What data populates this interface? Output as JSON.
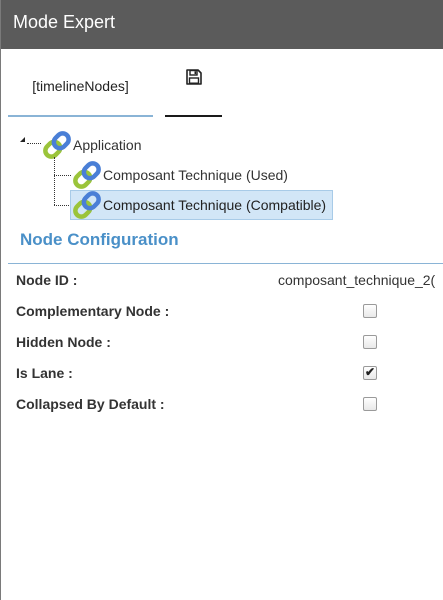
{
  "window": {
    "title": "Mode Expert"
  },
  "tabs": {
    "timeline_label": "[timelineNodes]",
    "save_icon": "floppy-disk-icon"
  },
  "tree": {
    "root": {
      "label": "Application",
      "icon": "chain-link-icon"
    },
    "children": [
      {
        "label": "Composant Technique (Used)",
        "icon": "chain-link-icon",
        "selected": false
      },
      {
        "label": "Composant Technique (Compatible)",
        "icon": "chain-link-icon",
        "selected": true
      }
    ]
  },
  "config": {
    "title": "Node Configuration",
    "fields": [
      {
        "label": "Node ID :",
        "value": "composant_technique_2("
      },
      {
        "label": "Complementary Node :",
        "checked": false
      },
      {
        "label": "Hidden Node :",
        "checked": false
      },
      {
        "label": "Is Lane :",
        "checked": true
      },
      {
        "label": "Collapsed By Default :",
        "checked": false
      }
    ]
  },
  "colors": {
    "titlebar": "#5b5b5b",
    "accent": "#4a90c8",
    "selection": "#d2e6f7"
  }
}
